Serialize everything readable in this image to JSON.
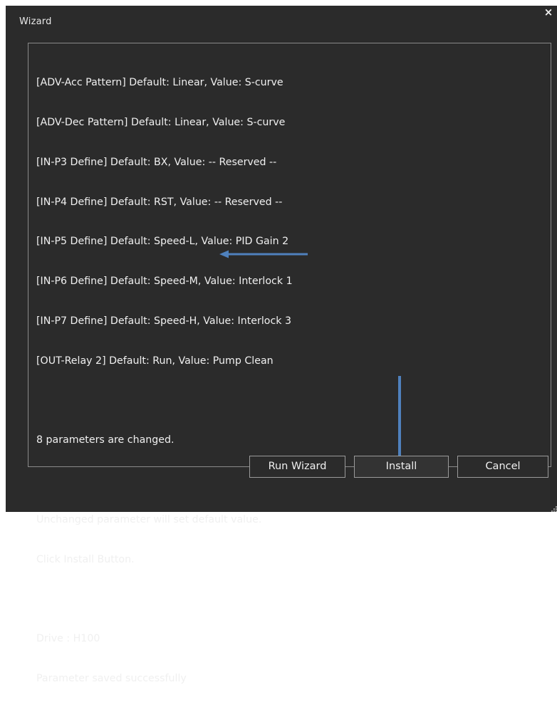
{
  "window": {
    "title": "Wizard",
    "close_glyph": "×"
  },
  "log": {
    "lines": [
      "[ADV-Acc Pattern] Default: Linear, Value: S-curve",
      "[ADV-Dec Pattern] Default: Linear, Value: S-curve",
      "[IN-P3 Define] Default: BX, Value: -- Reserved --",
      "[IN-P4 Define] Default: RST, Value: -- Reserved --",
      "[IN-P5 Define] Default: Speed-L, Value: PID Gain 2",
      "[IN-P6 Define] Default: Speed-M, Value: Interlock 1",
      "[IN-P7 Define] Default: Speed-H, Value: Interlock 3",
      "[OUT-Relay 2] Default: Run, Value: Pump Clean",
      "",
      "8 parameters are changed.",
      "",
      "Unchanged parameter will set default value.",
      "Click Install Button.",
      "",
      "Drive : H100",
      "Parameter saved successfully"
    ]
  },
  "buttons": {
    "run_wizard": "Run Wizard",
    "install": "Install",
    "cancel": "Cancel"
  },
  "colors": {
    "background": "#2b2b2b",
    "text": "#f0f0f0",
    "border": "#8a8a8a",
    "annotation_arrow": "#4f81bd"
  },
  "icons": {
    "close": "close-icon",
    "annotation_left": "arrow-left-icon",
    "annotation_down": "arrow-down-icon",
    "resize": "resize-grip-icon"
  }
}
